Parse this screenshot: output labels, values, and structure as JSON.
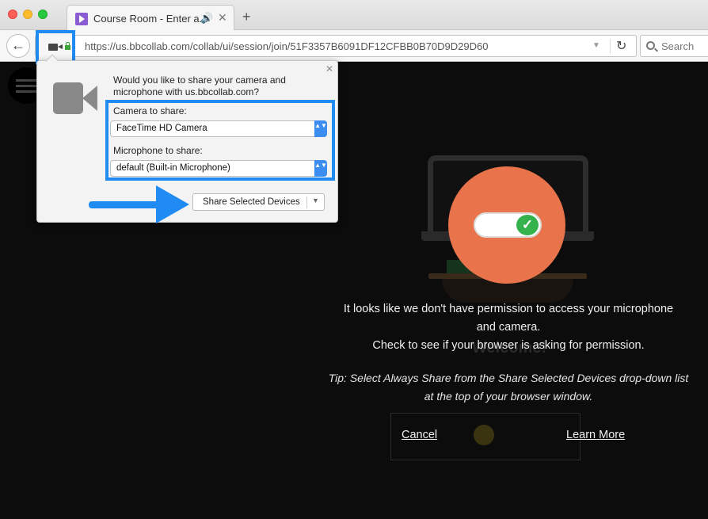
{
  "browser": {
    "tab_title": "Course Room - Enter a...",
    "tab_audio": "🔊",
    "tab_close": "✕",
    "new_tab": "+",
    "back": "←",
    "url": "https://us.bbcollab.com/collab/ui/session/join/51F3357B6091DF12CFBB0B70D9D29D60",
    "url_dropdown": "▼",
    "reload": "↻",
    "search_placeholder": "Search"
  },
  "permission_popup": {
    "close": "✕",
    "question": "Would you like to share your camera and microphone with us.bbcollab.com?",
    "camera_label": "Camera to share:",
    "camera_value": "FaceTime HD Camera",
    "microphone_label": "Microphone to share:",
    "microphone_value": "default (Built-in Microphone)",
    "select_arrows": "▲▼",
    "share_button": "Share Selected Devices",
    "share_dropdown": "▼"
  },
  "page": {
    "message_line1": "It looks like we don't have permission to access your microphone",
    "message_line2": "and camera.",
    "message_line3": "Check to see if your browser is asking for permission.",
    "tip_line1": "Tip: Select Always Share from the Share Selected Devices drop-down list",
    "tip_line2": "at the top of your browser window.",
    "background_welcome": "Welcome!",
    "toggle_check": "✓",
    "cancel": "Cancel",
    "learn_more": "Learn More"
  },
  "colors": {
    "highlight_blue": "#1f8bf3",
    "orange": "#e9734a",
    "toggle_green": "#35b24c"
  }
}
